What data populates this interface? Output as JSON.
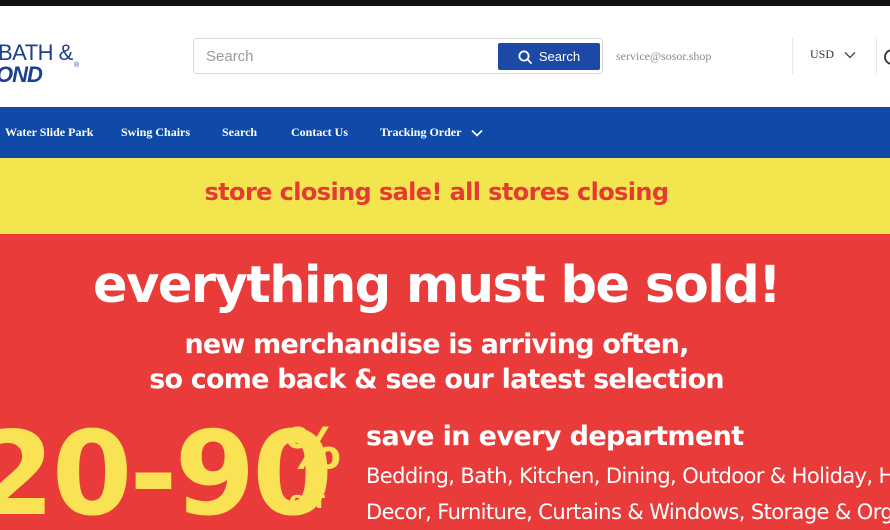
{
  "header": {
    "logo": {
      "line1": "BATH &",
      "line2": "OND",
      "registered_mark": "®"
    },
    "search": {
      "placeholder": "Search",
      "button_label": "Search"
    },
    "email": "service@sosor.shop",
    "currency": "USD"
  },
  "nav": {
    "items": [
      {
        "label": "Water Slide Park"
      },
      {
        "label": "Swing Chairs"
      },
      {
        "label": "Search"
      },
      {
        "label": "Contact Us"
      },
      {
        "label": "Tracking Order",
        "has_dropdown": true
      }
    ]
  },
  "banner": {
    "closing_text": "store closing sale! all stores closing",
    "headline": "everything must be sold!",
    "sub_line1": "new merchandise is arriving often,",
    "sub_line2": "so come back & see our latest selection",
    "discount_range": "20-90",
    "percent_sign": "%",
    "off_label": "off",
    "save_heading": "save in every department",
    "departments_line1": "Bedding, Bath, Kitchen, Dining, Outdoor & Holiday, Home",
    "departments_line2": "Decor, Furniture, Curtains & Windows, Storage & Organization"
  },
  "colors": {
    "nav_bg": "#0f4aa8",
    "search_button": "#1c49a5",
    "banner_yellow": "#f3e54e",
    "banner_red": "#ea3b3b",
    "accent_yellow": "#f9e253",
    "closing_text": "#e53a35"
  }
}
